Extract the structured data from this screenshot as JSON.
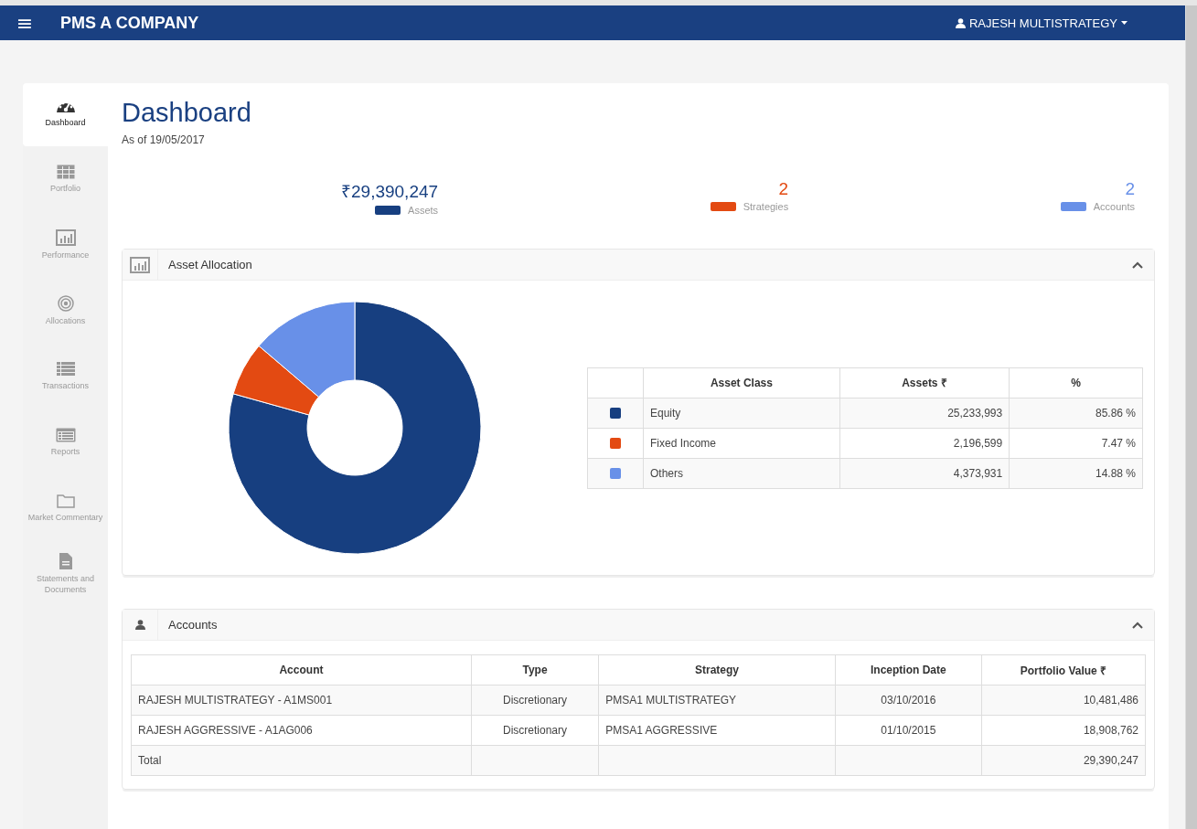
{
  "header": {
    "menu_icon": "≡",
    "brand": "PMS A COMPANY",
    "user": "RAJESH MULTISTRATEGY"
  },
  "sidebar": {
    "items": [
      {
        "label": "Dashboard",
        "selected": true
      },
      {
        "label": "Portfolio",
        "selected": false
      },
      {
        "label": "Performance",
        "selected": false
      },
      {
        "label": "Allocations",
        "selected": false
      },
      {
        "label": "Transactions",
        "selected": false
      },
      {
        "label": "Reports",
        "selected": false
      },
      {
        "label": "Market Commentary",
        "selected": false
      },
      {
        "label": "Statements and Documents",
        "selected": false
      }
    ]
  },
  "page": {
    "title": "Dashboard",
    "subtitle": "As of 19/05/2017"
  },
  "stats": [
    {
      "value": "₹29,390,247",
      "label": "Assets",
      "color": "#173f80"
    },
    {
      "value": "2",
      "label": "Strategies",
      "color": "#e34a12"
    },
    {
      "value": "2",
      "label": "Accounts",
      "color": "#6890e8"
    }
  ],
  "asset_allocation": {
    "title": "Asset Allocation",
    "table": {
      "columns": [
        "Asset Class",
        "Assets ₹",
        "%"
      ],
      "rows": [
        {
          "color": "#173f80",
          "asset_class": "Equity",
          "assets": "25,233,993",
          "percent": "85.86 %"
        },
        {
          "color": "#e34a12",
          "asset_class": "Fixed Income",
          "assets": "2,196,599",
          "percent": "7.47 %"
        },
        {
          "color": "#6890e8",
          "asset_class": "Others",
          "assets": "4,373,931",
          "percent": "14.88 %"
        }
      ]
    }
  },
  "accounts": {
    "title": "Accounts",
    "table": {
      "columns": [
        "Account",
        "Type",
        "Strategy",
        "Inception Date",
        "Portfolio Value ₹"
      ],
      "rows": [
        [
          "RAJESH MULTISTRATEGY - A1MS001",
          "Discretionary",
          "PMSA1 MULTISTRATEGY",
          "03/10/2016",
          "10,481,486"
        ],
        [
          "RAJESH AGGRESSIVE - A1AG006",
          "Discretionary",
          "PMSA1 AGGRESSIVE",
          "01/10/2015",
          "18,908,762"
        ],
        [
          "Total",
          "",
          "",
          "",
          "29,390,247"
        ]
      ]
    }
  }
}
